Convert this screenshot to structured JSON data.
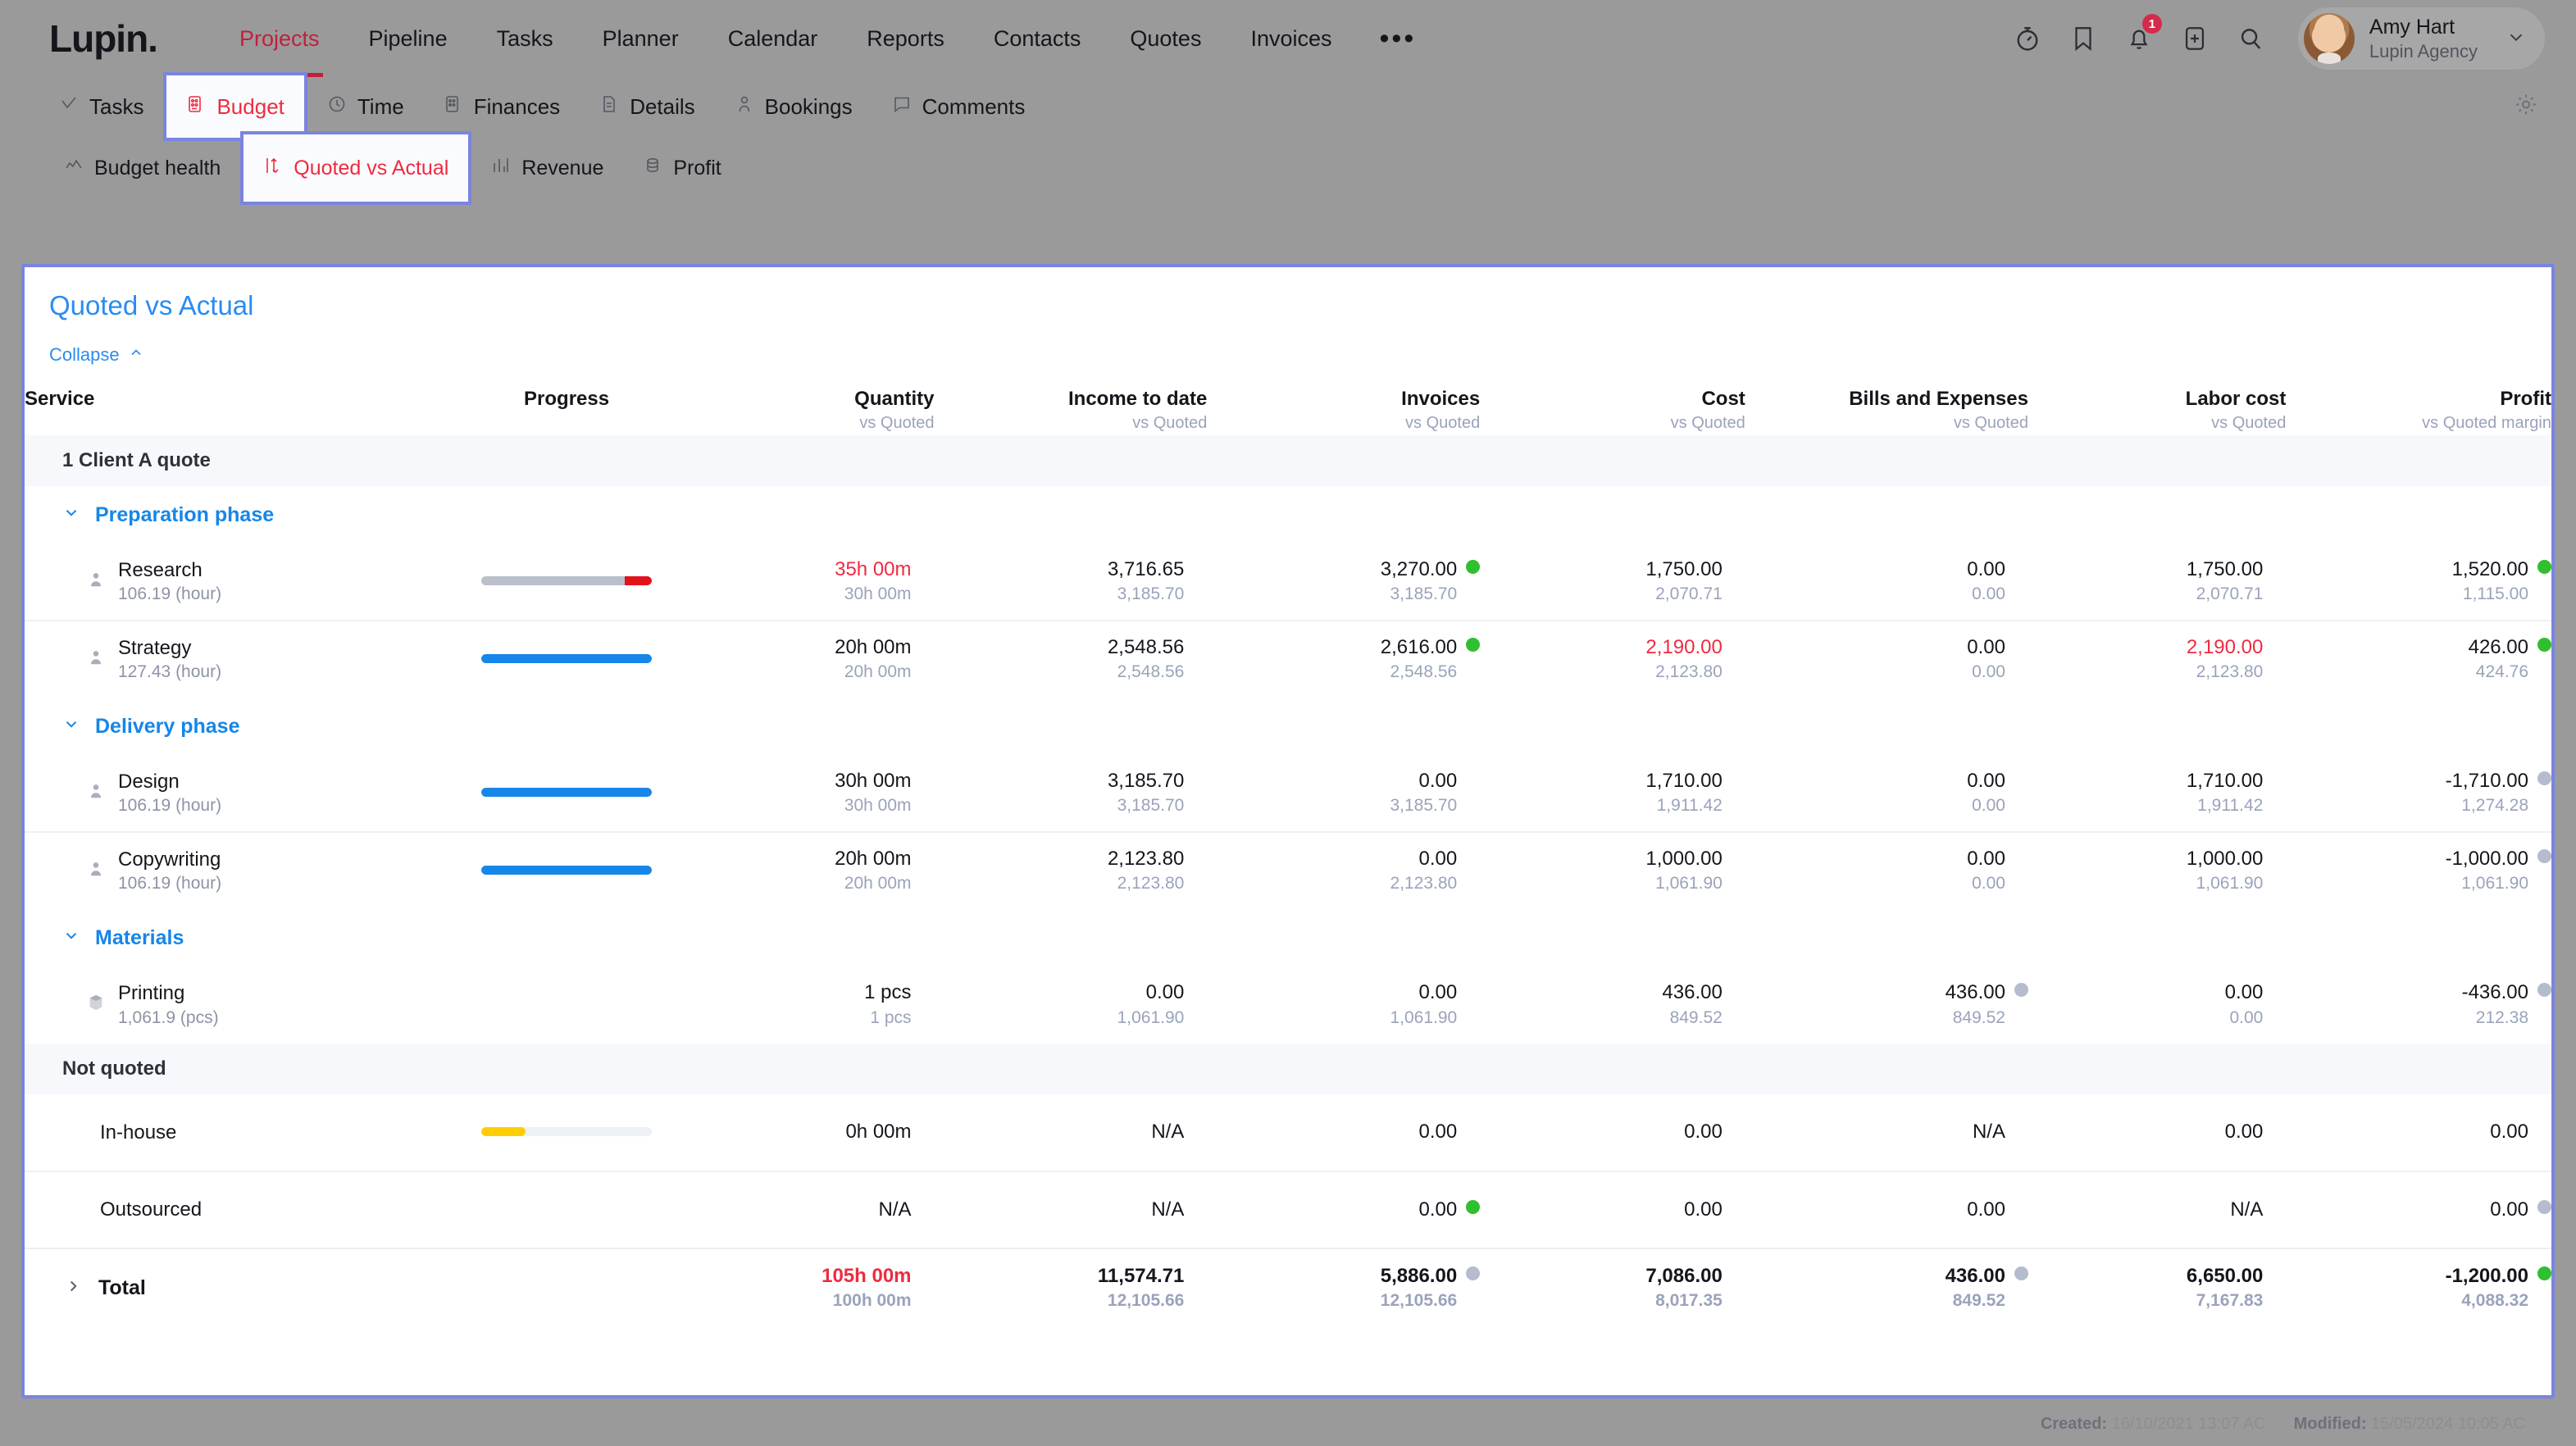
{
  "brand": "Lupin.",
  "topnav": {
    "links": [
      "Projects",
      "Pipeline",
      "Tasks",
      "Planner",
      "Calendar",
      "Reports",
      "Contacts",
      "Quotes",
      "Invoices"
    ],
    "active": "Projects",
    "more": "•••",
    "icons": [
      "timer-icon",
      "bookmark-icon",
      "bell-icon",
      "add-icon",
      "search-icon"
    ],
    "notification_count": "1",
    "user": {
      "name": "Amy Hart",
      "org": "Lupin Agency"
    }
  },
  "tabs_primary": {
    "items": [
      "Tasks",
      "Budget",
      "Time",
      "Finances",
      "Details",
      "Bookings",
      "Comments"
    ],
    "active": "Budget"
  },
  "tabs_secondary": {
    "items": [
      "Budget health",
      "Quoted vs Actual",
      "Revenue",
      "Profit"
    ],
    "active": "Quoted vs Actual"
  },
  "card": {
    "title": "Quoted vs Actual",
    "collapse_label": "Collapse"
  },
  "table": {
    "headers": [
      {
        "main": "Service",
        "sub": "",
        "align": "left"
      },
      {
        "main": "Progress",
        "sub": "",
        "align": "center"
      },
      {
        "main": "Quantity",
        "sub": "vs Quoted",
        "align": "right"
      },
      {
        "main": "Income to date",
        "sub": "vs Quoted",
        "align": "right"
      },
      {
        "main": "Invoices",
        "sub": "vs Quoted",
        "align": "right"
      },
      {
        "main": "Cost",
        "sub": "vs Quoted",
        "align": "right"
      },
      {
        "main": "Bills and Expenses",
        "sub": "vs Quoted",
        "align": "right"
      },
      {
        "main": "Labor cost",
        "sub": "vs Quoted",
        "align": "right"
      },
      {
        "main": "Profit",
        "sub": "vs Quoted margin",
        "align": "right"
      }
    ],
    "group_quote": "1 Client A quote",
    "group_not_quoted": "Not quoted",
    "phases": [
      {
        "name": "Preparation phase",
        "rows": [
          {
            "icon": "person-icon",
            "name": "Research",
            "rate": "106.19 (hour)",
            "progress": {
              "pct": 100,
              "color": "#b9bfcb",
              "over_pct": 16,
              "over_color": "#e3121a"
            },
            "cells": [
              {
                "v1": "35h 00m",
                "v2": "30h 00m",
                "v1_color": "red",
                "dot": ""
              },
              {
                "v1": "3,716.65",
                "v2": "3,185.70",
                "v1_color": "",
                "dot": ""
              },
              {
                "v1": "3,270.00",
                "v2": "3,185.70",
                "v1_color": "",
                "dot": "green"
              },
              {
                "v1": "1,750.00",
                "v2": "2,070.71",
                "v1_color": "",
                "dot": ""
              },
              {
                "v1": "0.00",
                "v2": "0.00",
                "v1_color": "",
                "dot": ""
              },
              {
                "v1": "1,750.00",
                "v2": "2,070.71",
                "v1_color": "",
                "dot": ""
              },
              {
                "v1": "1,520.00",
                "v2": "1,115.00",
                "v1_color": "",
                "dot": "green"
              }
            ]
          },
          {
            "icon": "person-icon",
            "name": "Strategy",
            "rate": "127.43 (hour)",
            "progress": {
              "pct": 100,
              "color": "#1686e8",
              "over_pct": 0,
              "over_color": ""
            },
            "cells": [
              {
                "v1": "20h 00m",
                "v2": "20h 00m",
                "v1_color": "",
                "dot": ""
              },
              {
                "v1": "2,548.56",
                "v2": "2,548.56",
                "v1_color": "",
                "dot": ""
              },
              {
                "v1": "2,616.00",
                "v2": "2,548.56",
                "v1_color": "",
                "dot": "green"
              },
              {
                "v1": "2,190.00",
                "v2": "2,123.80",
                "v1_color": "red",
                "dot": ""
              },
              {
                "v1": "0.00",
                "v2": "0.00",
                "v1_color": "",
                "dot": ""
              },
              {
                "v1": "2,190.00",
                "v2": "2,123.80",
                "v1_color": "red",
                "dot": ""
              },
              {
                "v1": "426.00",
                "v2": "424.76",
                "v1_color": "",
                "dot": "green"
              }
            ]
          }
        ]
      },
      {
        "name": "Delivery phase",
        "rows": [
          {
            "icon": "person-icon",
            "name": "Design",
            "rate": "106.19 (hour)",
            "progress": {
              "pct": 100,
              "color": "#1686e8",
              "over_pct": 0,
              "over_color": ""
            },
            "cells": [
              {
                "v1": "30h 00m",
                "v2": "30h 00m",
                "v1_color": "",
                "dot": ""
              },
              {
                "v1": "3,185.70",
                "v2": "3,185.70",
                "v1_color": "",
                "dot": ""
              },
              {
                "v1": "0.00",
                "v2": "3,185.70",
                "v1_color": "",
                "dot": ""
              },
              {
                "v1": "1,710.00",
                "v2": "1,911.42",
                "v1_color": "",
                "dot": ""
              },
              {
                "v1": "0.00",
                "v2": "0.00",
                "v1_color": "",
                "dot": ""
              },
              {
                "v1": "1,710.00",
                "v2": "1,911.42",
                "v1_color": "",
                "dot": ""
              },
              {
                "v1": "-1,710.00",
                "v2": "1,274.28",
                "v1_color": "",
                "dot": "grey"
              }
            ]
          },
          {
            "icon": "person-icon",
            "name": "Copywriting",
            "rate": "106.19 (hour)",
            "progress": {
              "pct": 100,
              "color": "#1686e8",
              "over_pct": 0,
              "over_color": ""
            },
            "cells": [
              {
                "v1": "20h 00m",
                "v2": "20h 00m",
                "v1_color": "",
                "dot": ""
              },
              {
                "v1": "2,123.80",
                "v2": "2,123.80",
                "v1_color": "",
                "dot": ""
              },
              {
                "v1": "0.00",
                "v2": "2,123.80",
                "v1_color": "",
                "dot": ""
              },
              {
                "v1": "1,000.00",
                "v2": "1,061.90",
                "v1_color": "",
                "dot": ""
              },
              {
                "v1": "0.00",
                "v2": "0.00",
                "v1_color": "",
                "dot": ""
              },
              {
                "v1": "1,000.00",
                "v2": "1,061.90",
                "v1_color": "",
                "dot": ""
              },
              {
                "v1": "-1,000.00",
                "v2": "1,061.90",
                "v1_color": "",
                "dot": "grey"
              }
            ]
          }
        ]
      },
      {
        "name": "Materials",
        "rows": [
          {
            "icon": "box-icon",
            "name": "Printing",
            "rate": "1,061.9 (pcs)",
            "progress": null,
            "cells": [
              {
                "v1": "1 pcs",
                "v2": "1 pcs",
                "v1_color": "",
                "dot": ""
              },
              {
                "v1": "0.00",
                "v2": "1,061.90",
                "v1_color": "",
                "dot": ""
              },
              {
                "v1": "0.00",
                "v2": "1,061.90",
                "v1_color": "",
                "dot": ""
              },
              {
                "v1": "436.00",
                "v2": "849.52",
                "v1_color": "",
                "dot": ""
              },
              {
                "v1": "436.00",
                "v2": "849.52",
                "v1_color": "",
                "dot": "grey"
              },
              {
                "v1": "0.00",
                "v2": "0.00",
                "v1_color": "",
                "dot": ""
              },
              {
                "v1": "-436.00",
                "v2": "212.38",
                "v1_color": "",
                "dot": "grey"
              }
            ]
          }
        ]
      }
    ],
    "not_quoted_rows": [
      {
        "icon": "",
        "name": "In-house",
        "rate": "",
        "progress": {
          "pct": 26,
          "color": "#ffce00",
          "over_pct": 0,
          "over_color": ""
        },
        "cells": [
          {
            "v1": "0h 00m",
            "v2": "",
            "v1_color": "",
            "dot": ""
          },
          {
            "v1": "N/A",
            "v2": "",
            "v1_color": "",
            "dot": ""
          },
          {
            "v1": "0.00",
            "v2": "",
            "v1_color": "",
            "dot": ""
          },
          {
            "v1": "0.00",
            "v2": "",
            "v1_color": "",
            "dot": ""
          },
          {
            "v1": "N/A",
            "v2": "",
            "v1_color": "",
            "dot": ""
          },
          {
            "v1": "0.00",
            "v2": "",
            "v1_color": "",
            "dot": ""
          },
          {
            "v1": "0.00",
            "v2": "",
            "v1_color": "",
            "dot": ""
          }
        ]
      },
      {
        "icon": "",
        "name": "Outsourced",
        "rate": "",
        "progress": null,
        "cells": [
          {
            "v1": "N/A",
            "v2": "",
            "v1_color": "",
            "dot": ""
          },
          {
            "v1": "N/A",
            "v2": "",
            "v1_color": "",
            "dot": ""
          },
          {
            "v1": "0.00",
            "v2": "",
            "v1_color": "",
            "dot": "green"
          },
          {
            "v1": "0.00",
            "v2": "",
            "v1_color": "",
            "dot": ""
          },
          {
            "v1": "0.00",
            "v2": "",
            "v1_color": "",
            "dot": ""
          },
          {
            "v1": "N/A",
            "v2": "",
            "v1_color": "",
            "dot": ""
          },
          {
            "v1": "0.00",
            "v2": "",
            "v1_color": "",
            "dot": "grey"
          }
        ]
      }
    ],
    "total": {
      "label": "Total",
      "cells": [
        {
          "v1": "105h 00m",
          "v2": "100h 00m",
          "v1_color": "red",
          "dot": ""
        },
        {
          "v1": "11,574.71",
          "v2": "12,105.66",
          "v1_color": "",
          "dot": ""
        },
        {
          "v1": "5,886.00",
          "v2": "12,105.66",
          "v1_color": "",
          "dot": "grey"
        },
        {
          "v1": "7,086.00",
          "v2": "8,017.35",
          "v1_color": "",
          "dot": ""
        },
        {
          "v1": "436.00",
          "v2": "849.52",
          "v1_color": "",
          "dot": "grey"
        },
        {
          "v1": "6,650.00",
          "v2": "7,167.83",
          "v1_color": "",
          "dot": ""
        },
        {
          "v1": "-1,200.00",
          "v2": "4,088.32",
          "v1_color": "",
          "dot": "green"
        }
      ]
    }
  },
  "footer": {
    "created_label": "Created:",
    "created_value": "16/10/2021 13:07 AC",
    "modified_label": "Modified:",
    "modified_value": "15/05/2024 10:05 AC"
  }
}
